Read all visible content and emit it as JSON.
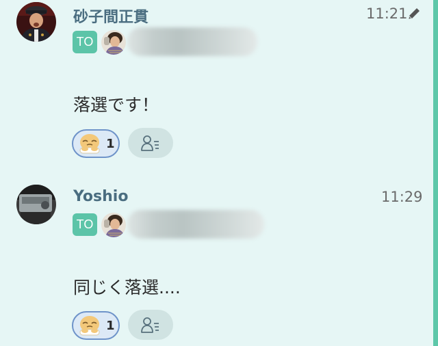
{
  "messages": [
    {
      "sender": "砂子間正貫",
      "time": "11:21",
      "edited_icon": "pencil-icon",
      "to_label": "TO",
      "text": "落選です！",
      "reaction": {
        "emoji": "sad-face-emoji",
        "count": "1"
      },
      "readers_icon": "read-by-users-icon"
    },
    {
      "sender": "Yoshio",
      "time": "11:29",
      "to_label": "TO",
      "text": "同じく落選....",
      "reaction": {
        "emoji": "sad-face-emoji",
        "count": "1"
      },
      "readers_icon": "read-by-users-icon"
    }
  ],
  "colors": {
    "background": "#e6f6f5",
    "accent_bar": "#5dc7a9",
    "to_badge": "#5cc4a8",
    "sender_name": "#4a6d80",
    "reaction_border": "#6e93c9",
    "reaction_fill": "#dce9f6"
  }
}
